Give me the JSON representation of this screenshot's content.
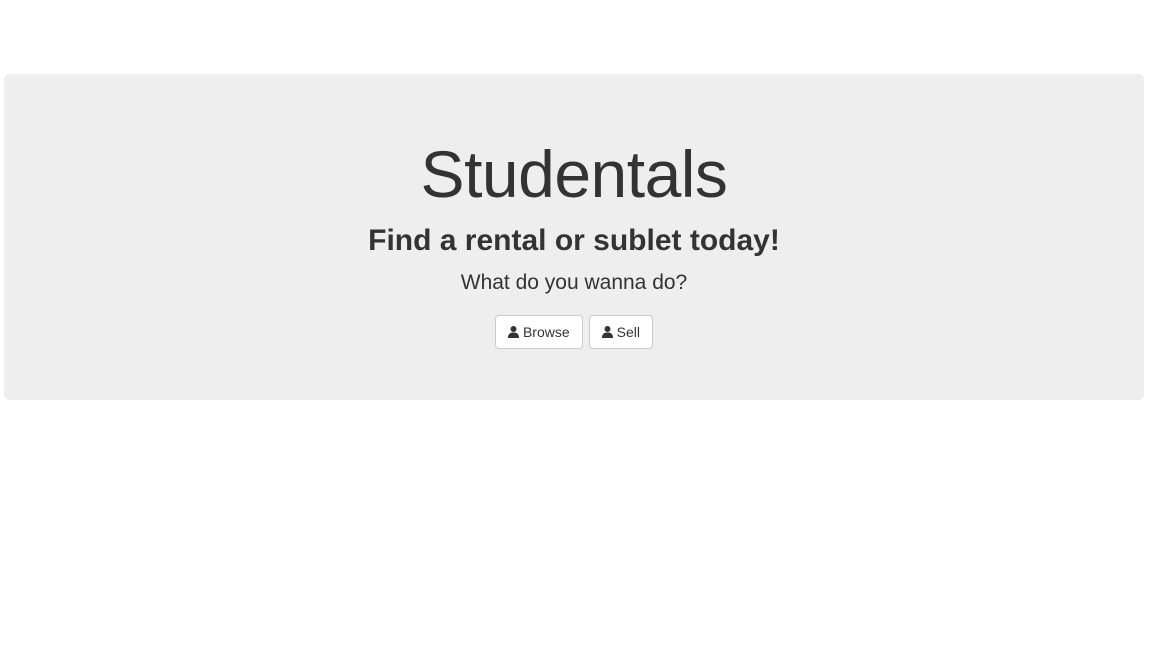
{
  "hero": {
    "title": "Studentals",
    "subtitle": "Find a rental or sublet today!",
    "prompt": "What do you wanna do?",
    "background_color": "#eeeeee",
    "text_color": "#333333"
  },
  "actions": {
    "browse": {
      "label": "Browse",
      "icon": "user-icon"
    },
    "sell": {
      "label": "Sell",
      "icon": "user-icon"
    }
  }
}
